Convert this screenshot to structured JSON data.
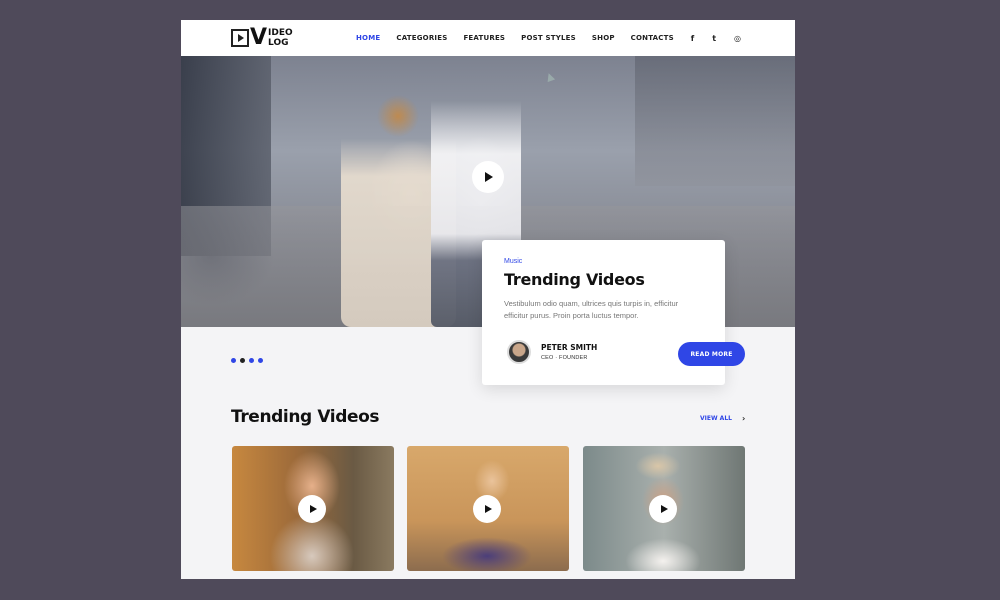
{
  "logo": {
    "mark": "V",
    "line1": "IDEO",
    "line2": "LOG"
  },
  "nav": [
    {
      "label": "HOME",
      "active": true
    },
    {
      "label": "CATEGORIES",
      "active": false
    },
    {
      "label": "FEATURES",
      "active": false
    },
    {
      "label": "POST STYLES",
      "active": false
    },
    {
      "label": "SHOP",
      "active": false
    },
    {
      "label": "CONTACTS",
      "active": false
    }
  ],
  "social": {
    "facebook": "f",
    "twitter": "t",
    "instagram": "◎"
  },
  "hero_card": {
    "category": "Music",
    "title": "Trending Videos",
    "description": "Vestibulum odio quam, ultrices quis turpis in, efficitur efficitur purus. Proin porta luctus tempor.",
    "author_name": "PETER SMITH",
    "author_role": "CEO · FOUNDER",
    "button": "READ MORE"
  },
  "slider": {
    "count": 4,
    "active_index": 1
  },
  "section": {
    "title": "Trending Videos",
    "view_all": "VIEW ALL",
    "chevron": "›"
  },
  "colors": {
    "accent": "#2f46e6",
    "background": "#4f4a5a",
    "page": "#f4f4f6"
  },
  "icons": [
    "play-icon",
    "facebook-icon",
    "twitter-icon",
    "instagram-icon",
    "chevron-right-icon"
  ]
}
